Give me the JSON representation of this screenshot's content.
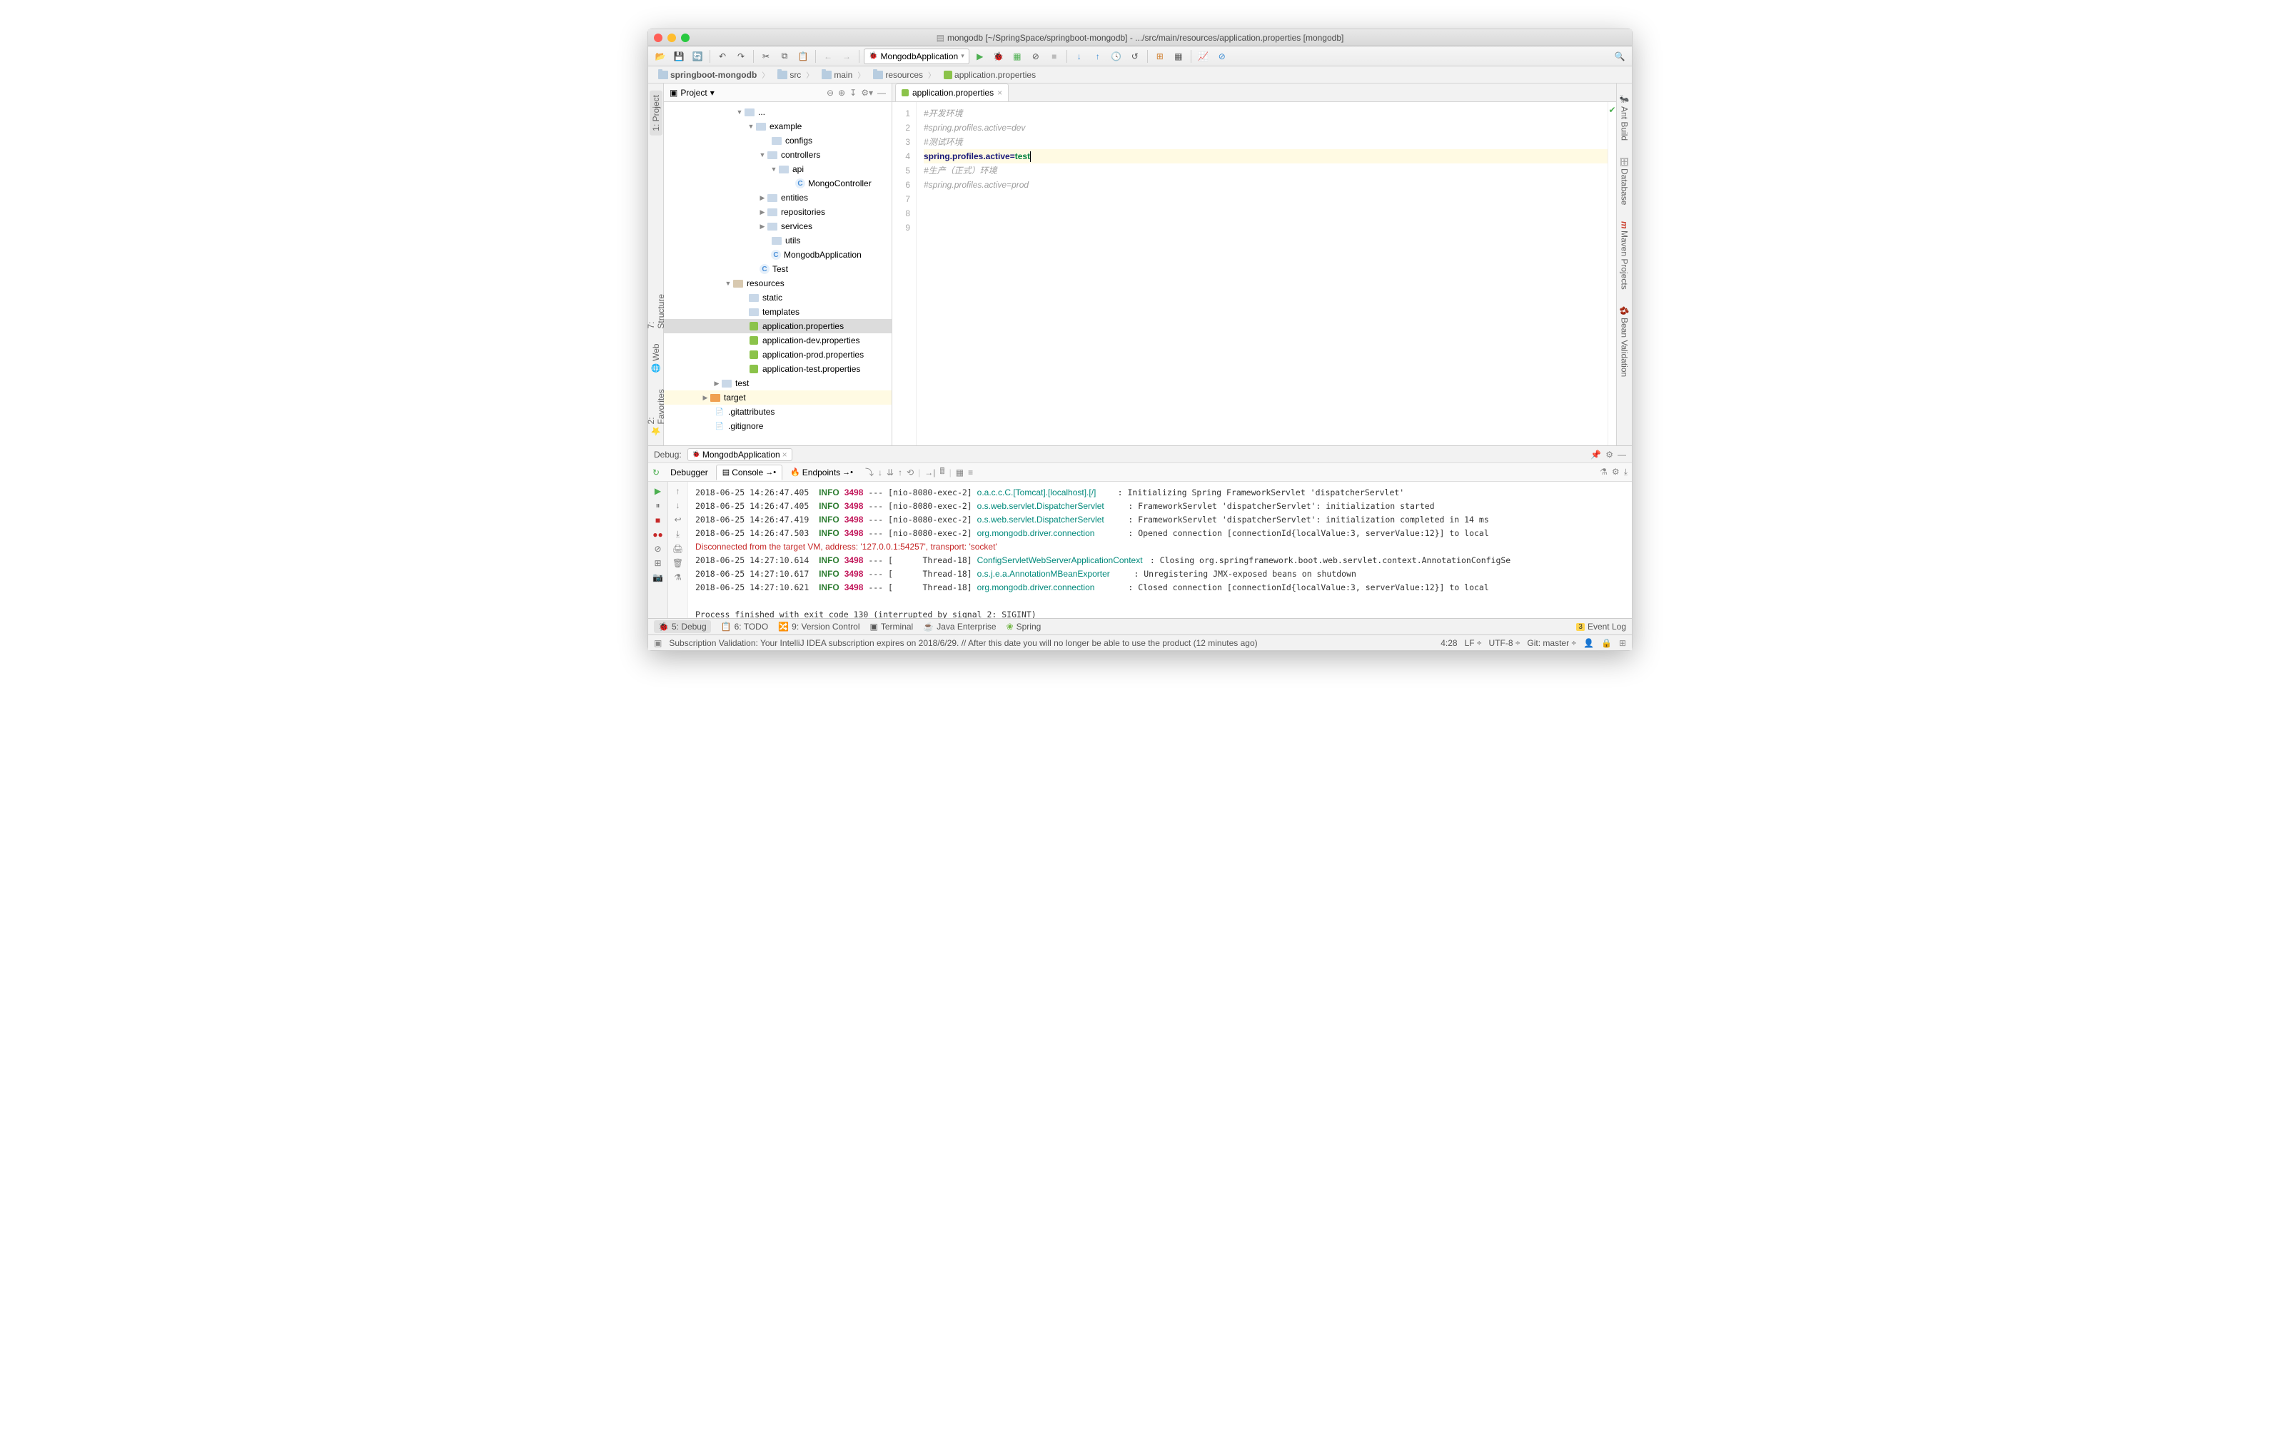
{
  "window": {
    "title": "mongodb [~/SpringSpace/springboot-mongodb] - .../src/main/resources/application.properties [mongodb]"
  },
  "runConfig": {
    "name": "MongodbApplication"
  },
  "breadcrumbs": [
    "springboot-mongodb",
    "src",
    "main",
    "resources",
    "application.properties"
  ],
  "leftTabs": {
    "project": "1: Project",
    "structure": "7: Structure",
    "web": "Web",
    "favorites": "2: Favorites"
  },
  "rightTabs": {
    "ant": "Ant Build",
    "database": "Database",
    "maven": "Maven Projects",
    "bean": "Bean Validation"
  },
  "projectPanel": {
    "title": "Project"
  },
  "tree": {
    "n0": "...",
    "example": "example",
    "configs": "configs",
    "controllers": "controllers",
    "api": "api",
    "mongoController": "MongoController",
    "entities": "entities",
    "repositories": "repositories",
    "services": "services",
    "utils": "utils",
    "mongoApp": "MongodbApplication",
    "test": "Test",
    "resources": "resources",
    "static": "static",
    "templates": "templates",
    "appProps": "application.properties",
    "appDev": "application-dev.properties",
    "appProd": "application-prod.properties",
    "appTest": "application-test.properties",
    "testDir": "test",
    "target": "target",
    "gitattr": ".gitattributes",
    "gitignore": ".gitignore"
  },
  "editor": {
    "tabName": "application.properties",
    "lines": {
      "l1": "#开发环境",
      "l2": "#spring.profiles.active=dev",
      "l3": "#测试环境",
      "l4k": "spring.profiles.active",
      "l4v": "test",
      "l5": "#生产（正式）环境",
      "l6": "#spring.profiles.active=prod"
    },
    "lineNums": [
      "1",
      "2",
      "3",
      "4",
      "5",
      "6",
      "7",
      "8",
      "9"
    ]
  },
  "debug": {
    "label": "Debug:",
    "config": "MongodbApplication",
    "tabs": {
      "debugger": "Debugger",
      "console": "Console",
      "endpoints": "Endpoints"
    }
  },
  "console": [
    {
      "ts": "2018-06-25 14:26:47.405",
      "lvl": "INFO",
      "pid": "3498",
      "thr": "[nio-8080-exec-2]",
      "cls": "o.a.c.c.C.[Tomcat].[localhost].[/]",
      "msg": ": Initializing Spring FrameworkServlet 'dispatcherServlet'"
    },
    {
      "ts": "2018-06-25 14:26:47.405",
      "lvl": "INFO",
      "pid": "3498",
      "thr": "[nio-8080-exec-2]",
      "cls": "o.s.web.servlet.DispatcherServlet",
      "msg": ": FrameworkServlet 'dispatcherServlet': initialization started"
    },
    {
      "ts": "2018-06-25 14:26:47.419",
      "lvl": "INFO",
      "pid": "3498",
      "thr": "[nio-8080-exec-2]",
      "cls": "o.s.web.servlet.DispatcherServlet",
      "msg": ": FrameworkServlet 'dispatcherServlet': initialization completed in 14 ms"
    },
    {
      "ts": "2018-06-25 14:26:47.503",
      "lvl": "INFO",
      "pid": "3498",
      "thr": "[nio-8080-exec-2]",
      "cls": "org.mongodb.driver.connection",
      "msg": ": Opened connection [connectionId{localValue:3, serverValue:12}] to local"
    }
  ],
  "consoleDisc": "Disconnected from the target VM, address: '127.0.0.1:54257', transport: 'socket'",
  "console2": [
    {
      "ts": "2018-06-25 14:27:10.614",
      "lvl": "INFO",
      "pid": "3498",
      "thr": "[      Thread-18]",
      "cls": "ConfigServletWebServerApplicationContext",
      "msg": ": Closing org.springframework.boot.web.servlet.context.AnnotationConfigSe"
    },
    {
      "ts": "2018-06-25 14:27:10.617",
      "lvl": "INFO",
      "pid": "3498",
      "thr": "[      Thread-18]",
      "cls": "o.s.j.e.a.AnnotationMBeanExporter",
      "msg": ": Unregistering JMX-exposed beans on shutdown"
    },
    {
      "ts": "2018-06-25 14:27:10.621",
      "lvl": "INFO",
      "pid": "3498",
      "thr": "[      Thread-18]",
      "cls": "org.mongodb.driver.connection",
      "msg": ": Closed connection [connectionId{localValue:3, serverValue:12}] to local"
    }
  ],
  "consoleExit": "Process finished with exit code 130 (interrupted by signal 2: SIGINT)",
  "bottomTabs": {
    "debug": "5: Debug",
    "todo": "6: TODO",
    "vcs": "9: Version Control",
    "terminal": "Terminal",
    "javaee": "Java Enterprise",
    "spring": "Spring",
    "eventBadge": "3",
    "eventLog": "Event Log"
  },
  "status": {
    "msg": "Subscription Validation: Your IntelliJ IDEA subscription expires on 2018/6/29. // After this date you will no longer be able to use the product (12 minutes ago)",
    "pos": "4:28",
    "sep": "LF",
    "enc": "UTF-8",
    "git": "Git: master"
  }
}
